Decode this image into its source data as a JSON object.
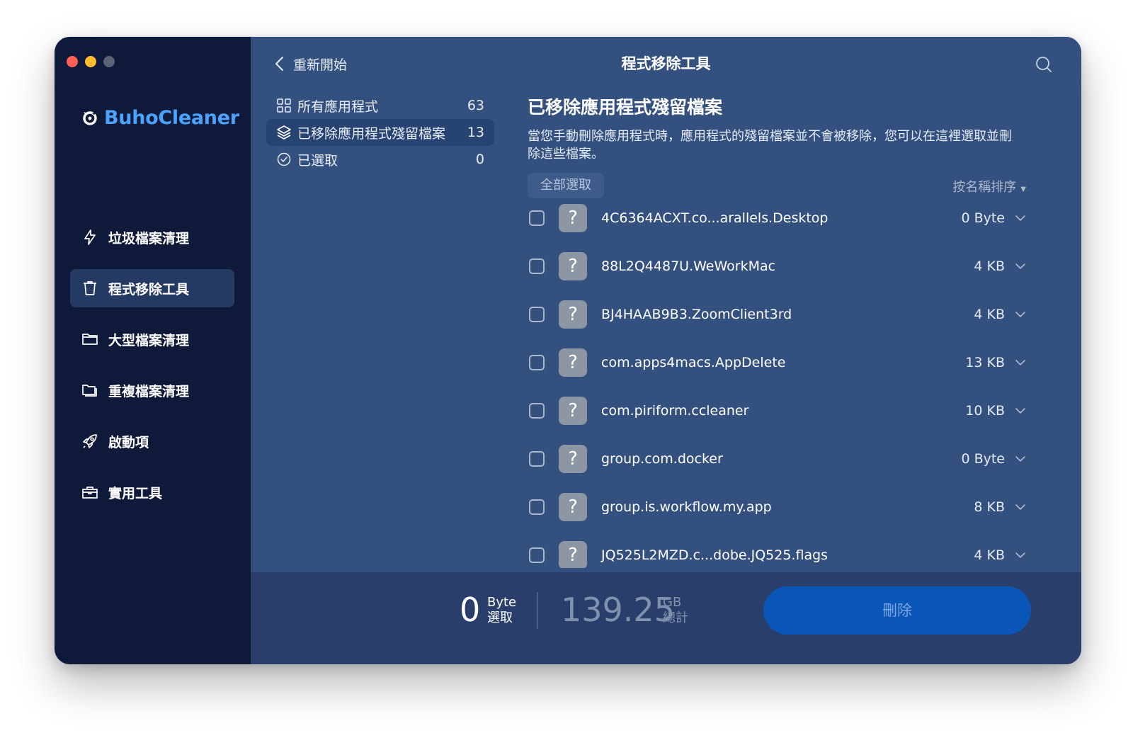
{
  "brand": {
    "name": "BuhoCleaner"
  },
  "sidebar": {
    "items": [
      {
        "label": "垃圾檔案清理",
        "icon": "bolt-icon",
        "active": false
      },
      {
        "label": "程式移除工具",
        "icon": "trash-icon",
        "active": true
      },
      {
        "label": "大型檔案清理",
        "icon": "folder-icon",
        "active": false
      },
      {
        "label": "重複檔案清理",
        "icon": "duplicate-folder-icon",
        "active": false
      },
      {
        "label": "啟動項",
        "icon": "rocket-icon",
        "active": false
      },
      {
        "label": "實用工具",
        "icon": "toolbox-icon",
        "active": false
      }
    ]
  },
  "header": {
    "back_label": "重新開始",
    "title": "程式移除工具"
  },
  "filters": [
    {
      "label": "所有應用程式",
      "count": "63",
      "icon": "grid-icon"
    },
    {
      "label": "已移除應用程式殘留檔案",
      "count": "13",
      "icon": "layers-icon"
    },
    {
      "label": "已選取",
      "count": "0",
      "icon": "check-circle-icon"
    }
  ],
  "section": {
    "title": "已移除應用程式殘留檔案",
    "description": "當您手動刪除應用程式時，應用程式的殘留檔案並不會被移除，您可以在這裡選取並刪除這些檔案。",
    "select_all": "全部選取",
    "sort": "按名稱排序"
  },
  "files": [
    {
      "name": "4C6364ACXT.co...arallels.Desktop",
      "size": "0 Byte"
    },
    {
      "name": "88L2Q4487U.WeWorkMac",
      "size": "4 KB"
    },
    {
      "name": "BJ4HAAB9B3.ZoomClient3rd",
      "size": "4 KB"
    },
    {
      "name": "com.apps4macs.AppDelete",
      "size": "13 KB"
    },
    {
      "name": "com.piriform.ccleaner",
      "size": "10 KB"
    },
    {
      "name": "group.com.docker",
      "size": "0 Byte"
    },
    {
      "name": "group.is.workflow.my.app",
      "size": "8 KB"
    },
    {
      "name": "JQ525L2MZD.c...dobe.JQ525.flags",
      "size": "4 KB"
    }
  ],
  "footer": {
    "selected_value": "0",
    "selected_unit": "Byte",
    "selected_label": "選取",
    "total_value": "139.25",
    "total_unit": "GB",
    "total_label": "總計",
    "delete_label": "刪除"
  },
  "colors": {
    "sidebar_bg": "#0f1a3a",
    "main_bg": "#33507f",
    "accent": "#4aa3ff",
    "delete_button": "#0a56b8"
  }
}
